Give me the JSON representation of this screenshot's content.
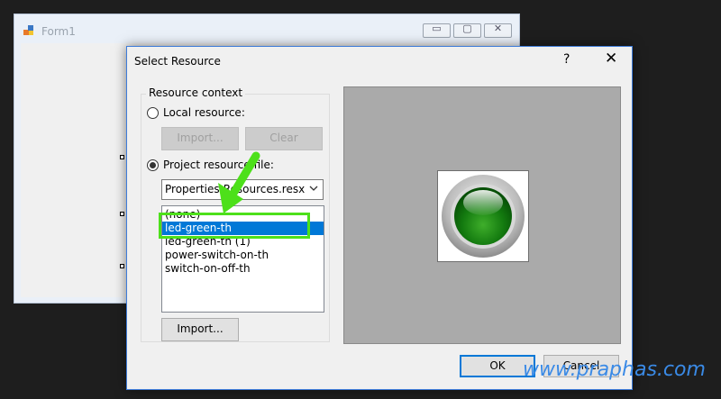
{
  "background_window": {
    "title": "Form1",
    "controls": {
      "minimize": "▭",
      "maximize": "▢",
      "close": "✕"
    }
  },
  "dialog": {
    "title": "Select Resource",
    "help_button": "?",
    "close_button": "✕",
    "resource_context": {
      "label": "Resource context",
      "local_resource_label": "Local resource:",
      "local_import_button": "Import...",
      "local_clear_button": "Clear",
      "project_resource_label": "Project resource file:",
      "project_resource_selected": true,
      "resource_file": "Properties\\Resources.resx",
      "items": [
        "(none)",
        "led-green-th",
        "led-green-th (1)",
        "power-switch-on-th",
        "switch-on-off-th"
      ],
      "selected_index": 1,
      "import_button": "Import..."
    },
    "ok_button": "OK",
    "cancel_button": "Cancel"
  },
  "watermark": "www.praphas.com",
  "colors": {
    "selection": "#0078d7",
    "highlight_box": "#4de01a",
    "watermark": "#3a8ae6"
  }
}
